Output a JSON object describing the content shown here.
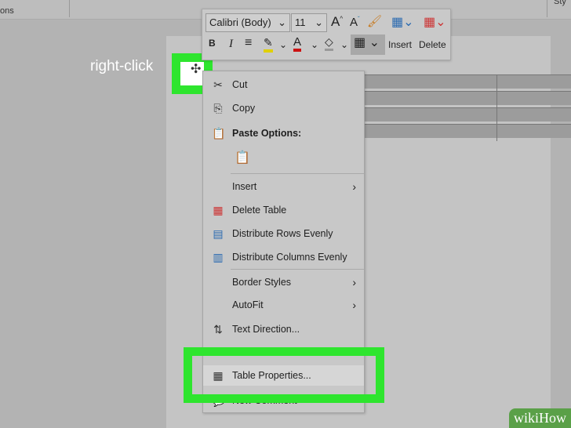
{
  "ribbon": {
    "left_label": "ons",
    "right_label": "Sty"
  },
  "annotation": "right-click",
  "mini_toolbar": {
    "font": "Calibri (Body)",
    "size": "11",
    "insert_label": "Insert",
    "delete_label": "Delete",
    "highlight_color": "#e0d000",
    "font_color": "#cc1111"
  },
  "menu": {
    "items": [
      {
        "label": "Cut",
        "icon": "scissors-icon"
      },
      {
        "label": "Copy",
        "icon": "copy-icon"
      },
      {
        "label": "Paste Options:",
        "icon": "paste-icon"
      },
      {
        "label": "Insert",
        "submenu": true
      },
      {
        "label": "Delete Table",
        "icon": "delete-table-icon"
      },
      {
        "label": "Distribute Rows Evenly",
        "icon": "distribute-rows-icon"
      },
      {
        "label": "Distribute Columns Evenly",
        "icon": "distribute-columns-icon"
      },
      {
        "label": "Border Styles",
        "submenu": true
      },
      {
        "label": "AutoFit",
        "submenu": true
      },
      {
        "label": "Text Direction...",
        "icon": "text-direction-icon"
      },
      {
        "label": "Table Properties...",
        "icon": "table-properties-icon",
        "highlighted": true
      },
      {
        "label": "New Comment",
        "icon": "comment-icon"
      }
    ]
  },
  "highlight_color": "#2ee52e",
  "watermark": "wikiHow"
}
